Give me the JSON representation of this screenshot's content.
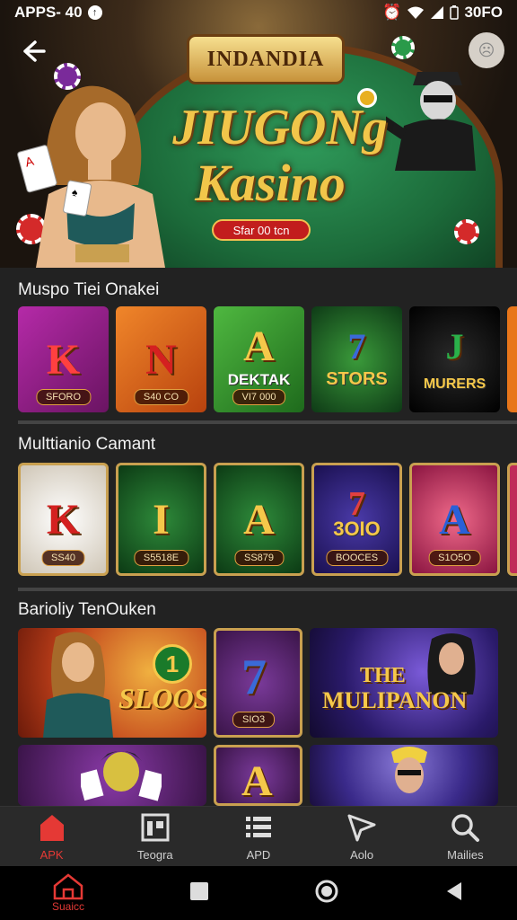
{
  "status": {
    "left": "APPS- 40",
    "right": "30FO"
  },
  "hero": {
    "brand": "INDANDIA",
    "title_line1": "JIUGONg",
    "title_line2": "Kasino",
    "button": "Sfar 00 tcn"
  },
  "sections": [
    {
      "title": "Muspo Tiei Onakei",
      "cards": [
        {
          "big": "K",
          "sub": "SFORO",
          "bg": "#8b1f86"
        },
        {
          "big": "N",
          "sub": "S40 CO",
          "bg": "#d6631b"
        },
        {
          "big": "A",
          "mid": "DEKTAK",
          "sub": "VI7 000",
          "bg": "#2f8a2c"
        },
        {
          "big": "7",
          "mid": "STORS",
          "bg": "#1f5a2a"
        },
        {
          "big": "J",
          "mid": "MURERS",
          "bg": "#111"
        }
      ]
    },
    {
      "title": "Multtianio Camant",
      "cards": [
        {
          "big": "K",
          "sub": "SS40",
          "bg": "#e8e2d6"
        },
        {
          "big": "I",
          "sub": "S5518E",
          "bg": "#1f6b2a"
        },
        {
          "big": "A",
          "sub": "SS879",
          "bg": "#1c5a26"
        },
        {
          "big": "7",
          "mid": "3OIO",
          "sub": "BOOCES",
          "bg": "#2a1e6e"
        },
        {
          "big": "A",
          "sub": "S1O5O",
          "bg": "#c02a5a"
        }
      ]
    },
    {
      "title": "Barioliy TenOuken",
      "tiles": [
        {
          "text": "SLOOS",
          "badge": "1"
        },
        {
          "text": "7",
          "sub": "SIO3"
        },
        {
          "text": "THE MULIPANON"
        },
        {
          "text": ""
        },
        {
          "text": "A"
        },
        {
          "text": ""
        }
      ]
    }
  ],
  "nav": [
    {
      "label": "APK",
      "icon": "home-icon",
      "active": true
    },
    {
      "label": "Teogra",
      "icon": "grid-icon",
      "active": false
    },
    {
      "label": "APD",
      "icon": "list-icon",
      "active": false
    },
    {
      "label": "Aolo",
      "icon": "send-icon",
      "active": false
    },
    {
      "label": "Mailies",
      "icon": "search-icon",
      "active": false
    }
  ],
  "sysbar": {
    "home_label": "Suaicc"
  },
  "colors": {
    "accent": "#e53935",
    "gold": "#f1c64a",
    "felt": "#1c6b3a"
  }
}
